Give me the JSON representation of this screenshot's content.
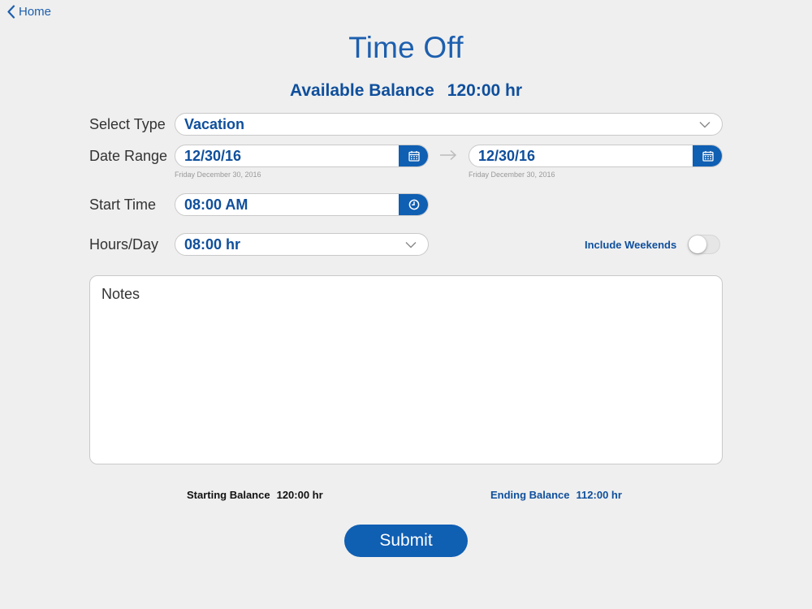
{
  "nav": {
    "back_label": "Home"
  },
  "page": {
    "title": "Time Off"
  },
  "available_balance": {
    "label": "Available Balance",
    "value": "120:00 hr"
  },
  "form": {
    "type": {
      "label": "Select Type",
      "value": "Vacation"
    },
    "date_range": {
      "label": "Date Range",
      "start": {
        "value": "12/30/16",
        "subtext": "Friday December 30, 2016"
      },
      "end": {
        "value": "12/30/16",
        "subtext": "Friday December 30, 2016"
      }
    },
    "start_time": {
      "label": "Start Time",
      "value": "08:00 AM"
    },
    "hours_per_day": {
      "label": "Hours/Day",
      "value": "08:00 hr"
    },
    "include_weekends": {
      "label": "Include Weekends",
      "on": false
    },
    "notes": {
      "placeholder": "Notes",
      "value": ""
    }
  },
  "summary": {
    "starting": {
      "label": "Starting Balance",
      "value": "120:00 hr"
    },
    "ending": {
      "label": "Ending Balance",
      "value": "112:00 hr"
    }
  },
  "actions": {
    "submit_label": "Submit"
  },
  "colors": {
    "accent": "#0f5fb3",
    "accent_text": "#0f4f9c",
    "background": "#efefef"
  },
  "icons": {
    "back": "chevron-left-icon",
    "dropdown": "chevron-down-icon",
    "date": "calendar-icon",
    "time": "clock-icon",
    "range": "arrow-right-icon"
  }
}
